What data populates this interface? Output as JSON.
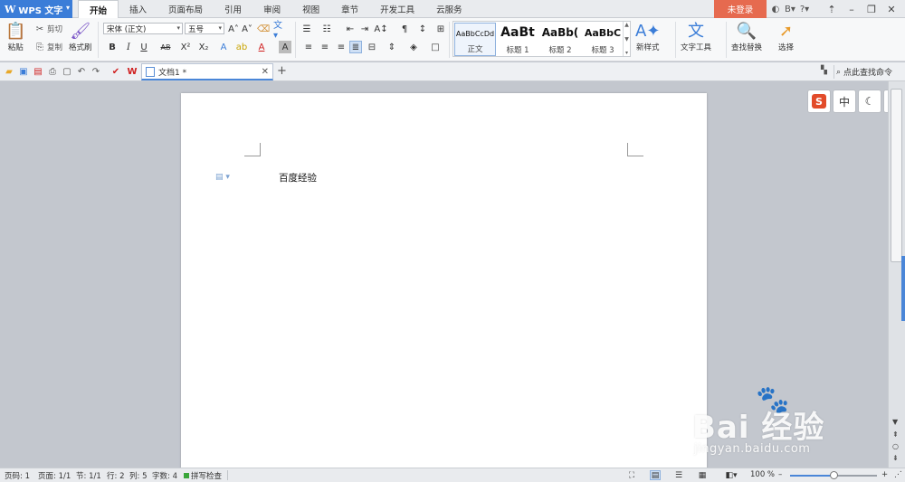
{
  "app": {
    "name": "WPS 文字"
  },
  "ribbon_tabs": [
    "开始",
    "插入",
    "页面布局",
    "引用",
    "审阅",
    "视图",
    "章节",
    "开发工具",
    "云服务"
  ],
  "login_label": "未登录",
  "clipboard": {
    "paste": "粘贴",
    "cut": "剪切",
    "copy": "复制",
    "format_painter": "格式刷"
  },
  "font": {
    "family": "宋体 (正文)",
    "size": "五号"
  },
  "styles": [
    {
      "sample": "AaBbCcDd",
      "name": "正文"
    },
    {
      "sample": "AaBt",
      "name": "标题 1"
    },
    {
      "sample": "AaBb(",
      "name": "标题 2"
    },
    {
      "sample": "AaBbC",
      "name": "标题 3"
    }
  ],
  "ribbon_buttons": {
    "new_style": "新样式",
    "text_tools": "文字工具",
    "find_replace": "查找替换",
    "select": "选择"
  },
  "document_tab": {
    "title": "文档1 *"
  },
  "search_command": "点此查找命令",
  "document": {
    "text": "百度经验"
  },
  "float_tools": {
    "zh": "中"
  },
  "status": {
    "page_num": "页码: 1",
    "pages": "页面: 1/1",
    "section": "节: 1/1",
    "row": "行: 2",
    "col": "列: 5",
    "word_count": "字数: 4",
    "spell_check": "拼写检查",
    "zoom": "100 %",
    "zoom_level": 0.5
  },
  "watermark": {
    "logo": "Bai  经验",
    "url": "jingyan.baidu.com"
  },
  "colors": {
    "accent": "#3b7dd8",
    "login": "#e66a4f",
    "canvas": "#c3c7ce"
  }
}
